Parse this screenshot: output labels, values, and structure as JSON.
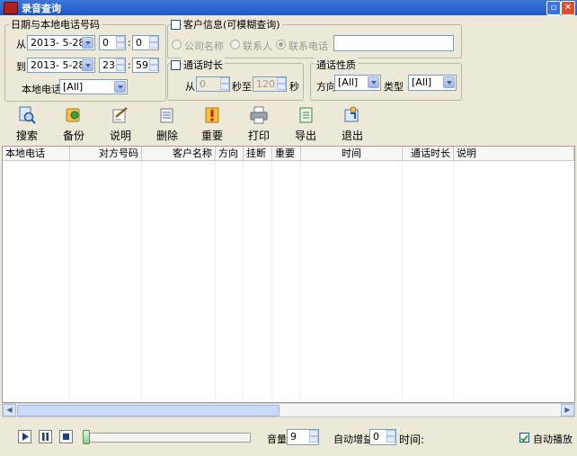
{
  "window": {
    "title": "录音查询"
  },
  "filters": {
    "date_group": "日期与本地电话号码",
    "from_label": "从",
    "from_date": "2013- 5-28",
    "from_hour": "0",
    "from_min": "0",
    "to_label": "到",
    "to_date": "2013- 5-28",
    "to_hour": "23",
    "to_min": "59",
    "time_sep": ":",
    "local_phone_label": "本地电话",
    "local_phone_value": "[All]"
  },
  "customer": {
    "title": "客户信息(可模糊查询)",
    "options": [
      "公司名称",
      "联系人",
      "联系电话"
    ],
    "selected": "联系电话",
    "search_value": ""
  },
  "duration": {
    "title": "通话时长",
    "from_label": "从",
    "from_value": "0",
    "mid_label": "秒至",
    "to_value": "120",
    "sec_label": "秒"
  },
  "nature": {
    "title": "通话性质",
    "direction_label": "方向",
    "direction_value": "[All]",
    "type_label": "类型",
    "type_value": "[All]"
  },
  "toolbar": [
    {
      "label": "搜索",
      "icon": "search-icon"
    },
    {
      "label": "备份",
      "icon": "backup-icon"
    },
    {
      "label": "说明",
      "icon": "note-icon"
    },
    {
      "label": "删除",
      "icon": "delete-icon"
    },
    {
      "label": "重要",
      "icon": "important-icon"
    },
    {
      "label": "打印",
      "icon": "printer-icon"
    },
    {
      "label": "导出",
      "icon": "export-icon"
    },
    {
      "label": "退出",
      "icon": "exit-icon"
    }
  ],
  "table": {
    "columns": [
      "本地电话",
      "对方号码",
      "客户名称",
      "方向",
      "挂断",
      "重要",
      "时间",
      "通话时长",
      "说明"
    ],
    "rows": []
  },
  "player": {
    "volume_label": "音量",
    "volume_value": "9",
    "gain_label": "自动增益",
    "gain_value": "0",
    "time_label": "时间:",
    "autoplay_label": "自动播放",
    "autoplay_checked": true
  },
  "colors": {
    "titlebar": "#2A63D2",
    "window_bg": "#ECE9D8",
    "accent": "#1C5180"
  }
}
